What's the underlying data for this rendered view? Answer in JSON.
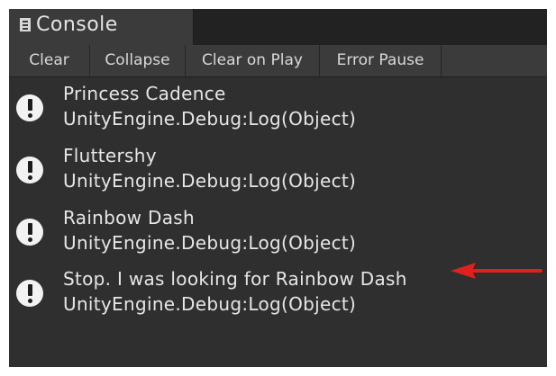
{
  "window": {
    "tab_title": "Console",
    "tab_icon": "console-document-icon"
  },
  "toolbar": {
    "clear_label": "Clear",
    "collapse_label": "Collapse",
    "clear_on_play_label": "Clear on Play",
    "error_pause_label": "Error Pause"
  },
  "log": {
    "entries": [
      {
        "message": "Princess Cadence",
        "trace": "UnityEngine.Debug:Log(Object)",
        "icon": "info-icon"
      },
      {
        "message": "Fluttershy",
        "trace": "UnityEngine.Debug:Log(Object)",
        "icon": "info-icon"
      },
      {
        "message": "Rainbow Dash",
        "trace": "UnityEngine.Debug:Log(Object)",
        "icon": "info-icon"
      },
      {
        "message": "Stop. I was looking for Rainbow Dash",
        "trace": "UnityEngine.Debug:Log(Object)",
        "icon": "info-icon"
      }
    ]
  },
  "annotation": {
    "arrow_color": "#e0201c",
    "arrow_icon": "red-arrow-icon"
  },
  "colors": {
    "panel_background": "#313131",
    "toolbar_background": "#3b3b3b",
    "text": "#e6e6e6"
  }
}
